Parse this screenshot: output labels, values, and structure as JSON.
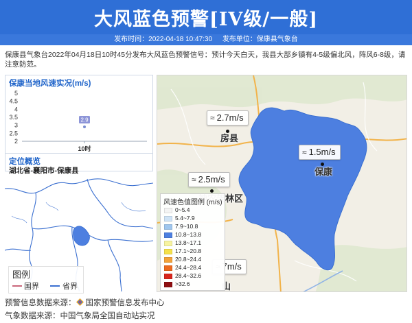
{
  "header": {
    "title": "大风蓝色预警[IV级/一般]",
    "publish_time": "发布时间：2022-04-18 10:47:30",
    "publisher": "发布单位：保康县气象台"
  },
  "description": "保康县气象台2022年04月18日10时45分发布大风蓝色预警信号：预计今天白天，我县大部乡镇有4-5级偏北风，阵风6-8级，请注意防范。",
  "wind_panel": {
    "title": "保康当地风速实况(m/s)"
  },
  "chart_data": {
    "type": "scatter",
    "title": "保康当地风速实况(m/s)",
    "categories": [
      "10时"
    ],
    "values": [
      2.9
    ],
    "data_labels": [
      "2.9"
    ],
    "y_ticks": [
      "5",
      "4.5",
      "4",
      "3.5",
      "3",
      "2.5",
      "2"
    ],
    "ylim": [
      2,
      5
    ],
    "grid": false
  },
  "location": {
    "title": "定位概览",
    "value": "湖北省-襄阳市-保康县"
  },
  "region_legend": {
    "title": "图例",
    "items": [
      {
        "label": "国界",
        "color": "#c9667a"
      },
      {
        "label": "省界",
        "color": "#3a6fd0"
      }
    ]
  },
  "main_map": {
    "wind_labels": [
      {
        "text": "2.7m/s",
        "icon": "wind-icon"
      },
      {
        "text": "1.5m/s",
        "icon": "wind-icon"
      },
      {
        "text": "2.5m/s",
        "icon": "wind-icon"
      },
      {
        "text": "7m/s",
        "icon": "wind-icon"
      }
    ],
    "places": [
      "房县",
      "保康",
      "神农架林区",
      "山"
    ],
    "county_fill_color": "#4d7fe0",
    "color_legend": {
      "title": "风速色值图例 (m/s)",
      "rows": [
        {
          "range": "0~5.4",
          "color": "#f4f4f4"
        },
        {
          "range": "5.4~7.9",
          "color": "#cfe3f6"
        },
        {
          "range": "7.9~10.8",
          "color": "#9fc6ee"
        },
        {
          "range": "10.8~13.8",
          "color": "#4d7fe0"
        },
        {
          "range": "13.8~17.1",
          "color": "#f7f3a0"
        },
        {
          "range": "17.1~20.8",
          "color": "#f5e14b"
        },
        {
          "range": "20.8~24.4",
          "color": "#f3a23a"
        },
        {
          "range": "24.4~28.4",
          "color": "#ec6a1f"
        },
        {
          "range": "28.4~32.6",
          "color": "#d8261e"
        },
        {
          "range": ">32.6",
          "color": "#8f0f12"
        }
      ]
    }
  },
  "footer": {
    "warning_source_label": "预警信息数据来源：",
    "warning_source": "国家预警信息发布中心",
    "weather_source": "气象数据来源：中国气象局全国自动站实况"
  }
}
